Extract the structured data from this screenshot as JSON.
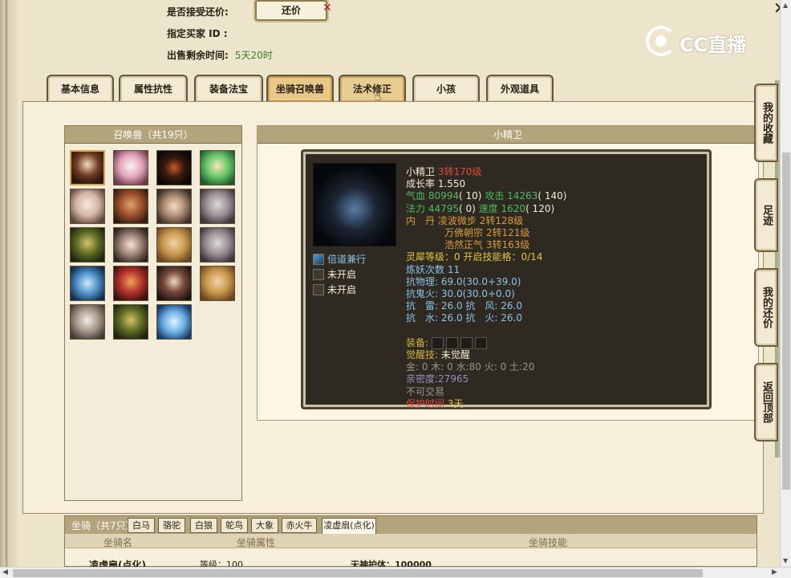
{
  "top_info": {
    "accept_bargain_label": "是否接受还价:",
    "bargain_button": "还价",
    "buyer_id_label": "指定买家 ID :",
    "remaining_time_label": "出售剩余时间:",
    "remaining_time_value": "5天20时"
  },
  "logo": {
    "text": "CC直播"
  },
  "tabs": [
    {
      "label": "基本信息"
    },
    {
      "label": "属性抗性"
    },
    {
      "label": "装备法宝"
    },
    {
      "label": "坐骑召唤兽"
    },
    {
      "label": "法术修正"
    },
    {
      "label": "小孩"
    },
    {
      "label": "外观道具"
    }
  ],
  "summon_panel": {
    "title": "召唤兽（共19只）"
  },
  "detail_panel": {
    "title": "小精卫"
  },
  "pet": {
    "name": "小精卫",
    "level": "3转170级",
    "growth": "成长率 1.550",
    "hp_label": "气血",
    "hp_value": "80994",
    "hp_pts": "( 10)",
    "atk_label": "攻击",
    "atk_value": "14263",
    "atk_pts": "( 140)",
    "mp_label": "法力",
    "mp_value": "44795",
    "mp_pts": "( 0)",
    "spd_label": "速度",
    "spd_value": "1620",
    "spd_pts": "( 120)",
    "inner_label": "内　丹",
    "inner1_name": "凌波微步",
    "inner1_lv": "2转128级",
    "inner2_name": "万佛朝宗",
    "inner2_lv": "2转121级",
    "inner3_name": "浩然正气",
    "inner3_lv": "3转163级",
    "spirit_label": "灵犀等级：",
    "spirit_value": "0",
    "skill_grid_label": "开启技能格：",
    "skill_grid_value": "0/14",
    "refine_label": "炼妖次数",
    "refine_value": "11",
    "phys_res": "抗物理: 69.0(30.0+39.0)",
    "ghost_res": "抗鬼火: 30.0(30.0+0.0)",
    "thunder_res": "抗　雷: 26.0",
    "wind_res": "抗　风: 26.0",
    "water_res": "抗　水: 26.0",
    "fire_res": "抗　火: 26.0",
    "equip_label": "装备:",
    "awaken_label": "觉醒技:",
    "awaken_value": "未觉醒",
    "elements": "金: 0 木: 0 水:80 火: 0 土:20",
    "intimacy": "亲密度:27965",
    "tradable": "不可交易",
    "protect_label": "保护时间",
    "protect_value": "3天",
    "skills": [
      {
        "label": "倍道兼行"
      },
      {
        "label": "未开启"
      },
      {
        "label": "未开启"
      }
    ]
  },
  "side_buttons": [
    {
      "label": "我的收藏"
    },
    {
      "label": "足迹"
    },
    {
      "label": "我的还价"
    },
    {
      "label": "返回顶部"
    }
  ],
  "mount_panel": {
    "title": "坐骑（共7只）",
    "tabs": [
      "白马",
      "骆驼",
      "白狼",
      "鸵鸟",
      "大象",
      "赤火牛",
      "凌虚扇(点化)"
    ],
    "col_name": "坐骑名",
    "col_attr": "坐骑属性",
    "col_skill": "坐骑技能",
    "row_name": "凌虚扇(点化)",
    "row_level": "等级：100",
    "row_skill": "天神护体：100000"
  }
}
